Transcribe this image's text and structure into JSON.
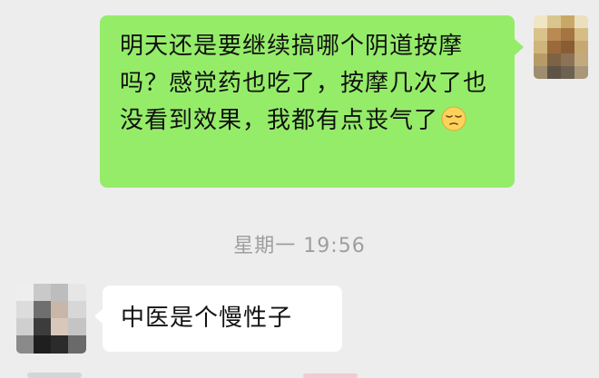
{
  "messages": {
    "outgoing": {
      "text": "明天还是要继续搞哪个阴道按摩吗？感觉药也吃了，按摩几次了也没看到效果，我都有点丧气了",
      "emoji": "pensive-face"
    },
    "timestamp": "星期一 19:56",
    "incoming": {
      "text": "中医是个慢性子"
    }
  }
}
